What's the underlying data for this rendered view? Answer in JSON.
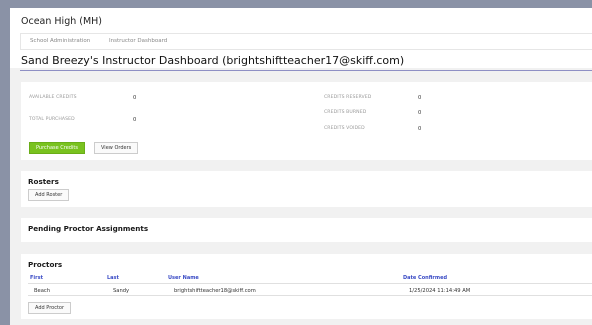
{
  "school": {
    "name": "Ocean High (MH)"
  },
  "nav": {
    "items": [
      "School Administration",
      "Instructor Dashboard"
    ]
  },
  "dashboard": {
    "title": "Sand Breezy's Instructor Dashboard (brightshiftteacher17@skiff.com)"
  },
  "credits": {
    "available_label": "AVAILABLE CREDITS",
    "available_value": "0",
    "total_purchased_label": "TOTAL PURCHASED",
    "total_purchased_value": "0",
    "reserved_label": "CREDITS RESERVED",
    "reserved_value": "0",
    "burned_label": "CREDITS BURNED",
    "burned_value": "0",
    "voided_label": "CREDITS VOIDED",
    "voided_value": "0",
    "purchase_button": "Purchase Credits",
    "view_orders_button": "View Orders"
  },
  "rosters": {
    "title": "Rosters",
    "add_button": "Add Roster"
  },
  "pending": {
    "title": "Pending Proctor Assignments"
  },
  "proctors": {
    "title": "Proctors",
    "columns": [
      "First",
      "Last",
      "User Name",
      "Date Confirmed"
    ],
    "rows": [
      {
        "first": "Beach",
        "last": "Sandy",
        "username": "brightshiftteacher18@skiff.com",
        "date": "1/25/2024 11:14:49 AM"
      }
    ],
    "add_button": "Add Proctor"
  },
  "colors": {
    "accent_green": "#79c21f",
    "header_link_blue": "#3a4bc5",
    "rule_purple": "#8e8fc4"
  }
}
